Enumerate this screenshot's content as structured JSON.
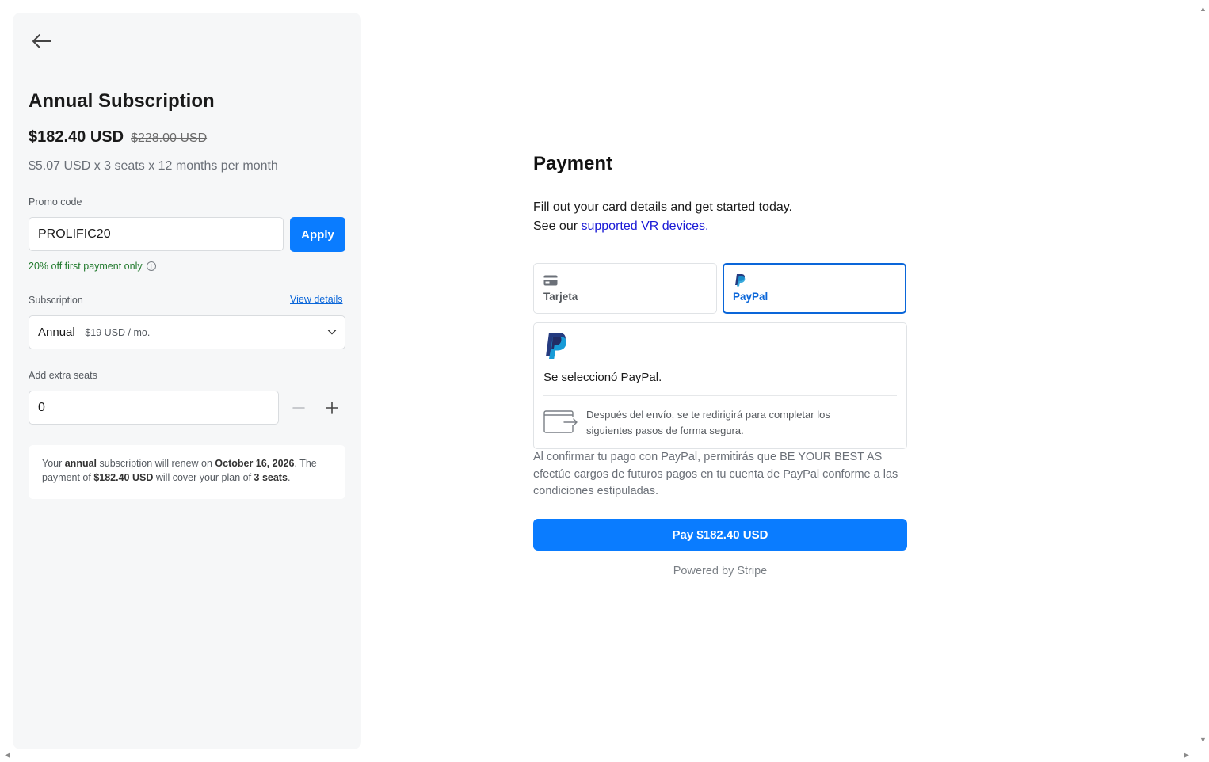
{
  "sidebar": {
    "back_icon": "arrow-left-icon",
    "plan_title": "Annual Subscription",
    "price": "$182.40 USD",
    "price_original": "$228.00 USD",
    "price_breakdown": "$5.07 USD x 3 seats x 12 months per month",
    "promo": {
      "label": "Promo code",
      "value": "PROLIFIC20",
      "apply_label": "Apply",
      "note": "20% off first payment only",
      "note_icon": "info-icon"
    },
    "subscription": {
      "label": "Subscription",
      "view_details": "View details",
      "selected_main": "Annual",
      "selected_sub": "- $19 USD / mo."
    },
    "seats": {
      "label": "Add extra seats",
      "value": "0"
    },
    "renewal": {
      "p1": "Your ",
      "plan": "annual",
      "p2": " subscription will renew on ",
      "date": "October 16, 2026",
      "p3": ". The payment of ",
      "amount": "$182.40 USD",
      "p4": " will cover your plan of ",
      "seats": "3 seats",
      "p5": "."
    }
  },
  "payment": {
    "title": "Payment",
    "desc_line1": "Fill out your card details and get started today.",
    "desc_line2_prefix": "See our ",
    "desc_link": "supported VR devices.",
    "tabs": [
      {
        "label": "Tarjeta",
        "icon": "card-icon",
        "active": false
      },
      {
        "label": "PayPal",
        "icon": "paypal-icon",
        "active": true
      }
    ],
    "paypal_selected": "Se seleccionó PayPal.",
    "redirect_text": "Después del envío, se te redirigirá para completar los siguientes pasos de forma segura.",
    "consent": "Al confirmar tu pago con PayPal, permitirás que BE YOUR BEST AS efectúe cargos de futuros pagos en tu cuenta de PayPal conforme a las condiciones estipuladas.",
    "pay_button": "Pay $182.40 USD",
    "powered_by": "Powered by Stripe"
  },
  "colors": {
    "accent": "#0a7cff",
    "link": "#0a66d9",
    "success": "#217a2d",
    "sidebar_bg": "#f6f7f8"
  }
}
